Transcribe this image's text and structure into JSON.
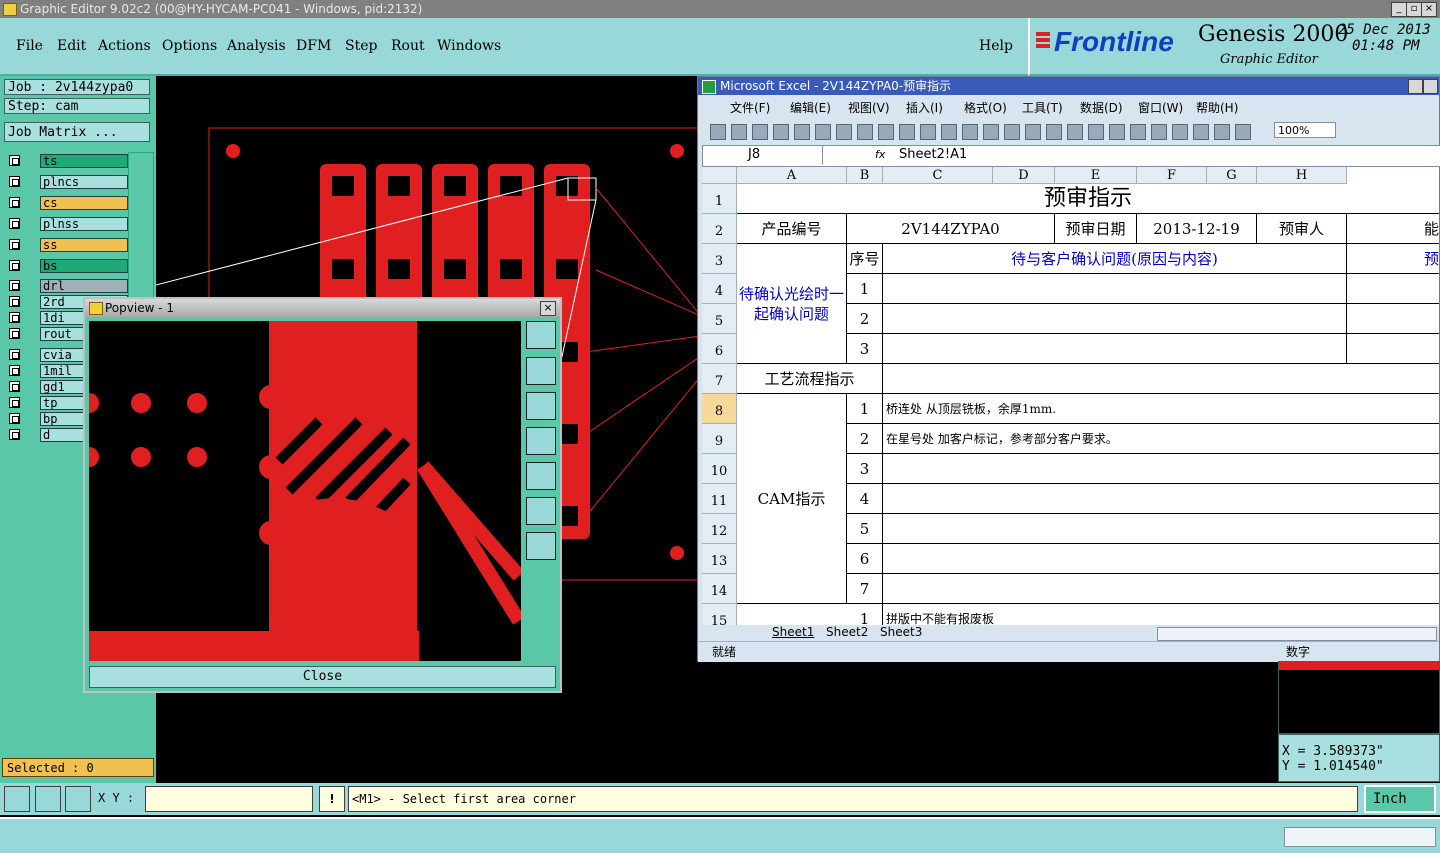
{
  "window": {
    "title": "Graphic Editor 9.02c2 (00@HY-HYCAM-PC041 - Windows, pid:2132)"
  },
  "menu": {
    "items": [
      "File",
      "Edit",
      "Actions",
      "Options",
      "Analysis",
      "DFM",
      "Step",
      "Rout",
      "Windows"
    ],
    "help": "Help"
  },
  "logo": {
    "brand": "Frontline",
    "product": "Genesis 2000",
    "subtitle": "Graphic Editor",
    "date": "25 Dec 2013",
    "time": "01:48 PM"
  },
  "job": {
    "job_label": "Job : 2v144zypa0",
    "step_label": "Step: cam",
    "matrix_button": "Job Matrix ..."
  },
  "layers": [
    {
      "name": "ts",
      "color": "#20a878"
    },
    {
      "name": "plncs",
      "color": "#a8e0e0"
    },
    {
      "name": "cs",
      "color": "#f0c050"
    },
    {
      "name": "plnss",
      "color": "#a8e0e0"
    },
    {
      "name": "ss",
      "color": "#f0c050"
    },
    {
      "name": "bs",
      "color": "#20a878"
    },
    {
      "name": "drl",
      "color": "#a0b0b8"
    },
    {
      "name": "2rd",
      "color": "#a8e0e0"
    },
    {
      "name": "1di",
      "color": "#a8e0e0"
    },
    {
      "name": "rout",
      "color": "#a8e0e0"
    },
    {
      "name": "cvia",
      "color": "#a8e0e0"
    },
    {
      "name": "1mil",
      "color": "#a8e0e0"
    },
    {
      "name": "gd1",
      "color": "#a8e0e0"
    },
    {
      "name": "tp",
      "color": "#a8e0e0"
    },
    {
      "name": "bp",
      "color": "#a8e0e0"
    },
    {
      "name": "d",
      "color": "#a8e0e0"
    }
  ],
  "selected": "Selected : 0",
  "popview": {
    "title": "Popview - 1",
    "close": "Close"
  },
  "command": {
    "xy_label": "X Y :",
    "xy_value": "",
    "message": "<M1> - Select first area corner",
    "unit": "Inch"
  },
  "coords": {
    "x": "X = 3.589373\"",
    "y": "Y = 1.014540\""
  },
  "excel": {
    "title": "Microsoft Excel - 2V144ZYPA0-预审指示",
    "menu": [
      "文件(F)",
      "编辑(E)",
      "视图(V)",
      "插入(I)",
      "格式(O)",
      "工具(T)",
      "数据(D)",
      "窗口(W)",
      "帮助(H)"
    ],
    "namebox": "J8",
    "fx": "fx",
    "formula": "Sheet2!A1",
    "zoom": "100%",
    "columns": [
      "A",
      "B",
      "C",
      "D",
      "E",
      "F",
      "G",
      "H"
    ],
    "rows": [
      "1",
      "2",
      "3",
      "4",
      "5",
      "6",
      "7",
      "8",
      "9",
      "10",
      "11",
      "12",
      "13",
      "14",
      "15"
    ],
    "cells": {
      "title": "预审指示",
      "product_label": "产品编号",
      "product_value": "2V144ZYPA0",
      "date_label": "预审日期",
      "date_value": "2013-12-19",
      "reviewer_label": "预审人",
      "partial_right": "能",
      "confirm_label": "待确认光绘时一起确认问题",
      "seq_label": "序号",
      "issue_header": "待与客户确认问题(原因与内容)",
      "partial_right2": "预",
      "seq": [
        "1",
        "2",
        "3"
      ],
      "process_label": "工艺流程指示",
      "cam_label": "CAM指示",
      "cam_seq": [
        "1",
        "2",
        "3",
        "4",
        "5",
        "6",
        "7"
      ],
      "cam_1": "桥连处 从顶层铣板，余厚1mm.",
      "cam_2": "在星号处 加客户标记，参考部分客户要求。",
      "row15_seq": "1",
      "row15_text": "拼版中不能有报废板"
    },
    "sheets": [
      "Sheet1",
      "Sheet2",
      "Sheet3"
    ],
    "status": "就绪",
    "status_right": "数字"
  }
}
